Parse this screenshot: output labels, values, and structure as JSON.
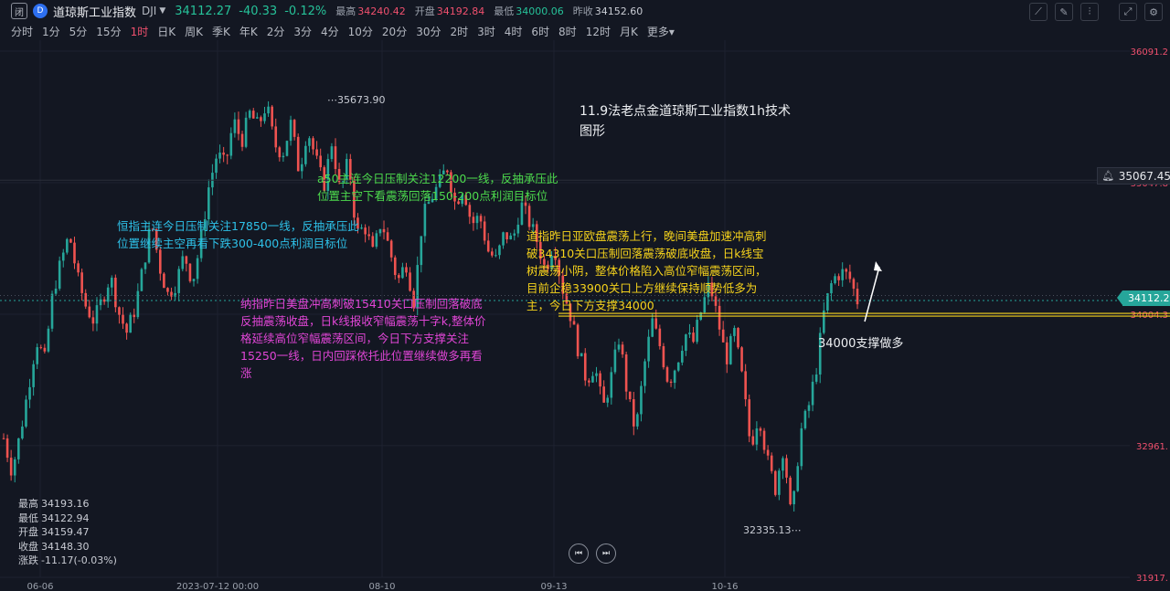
{
  "header": {
    "closed_badge": "闭",
    "logo_glyph": "D",
    "symbol_name": "道琼斯工业指数",
    "ticker": "DJI",
    "price": "34112.27",
    "change": "-40.33",
    "change_pct": "-0.12%",
    "high_label": "最高",
    "high": "34240.42",
    "open_label": "开盘",
    "open": "34192.84",
    "low_label": "最低",
    "low": "34000.06",
    "prev_label": "昨收",
    "prev": "34152.60",
    "tools": [
      "draw-line-icon",
      "pencil-icon",
      "indicator-icon",
      "fullscreen-icon",
      "settings-icon"
    ]
  },
  "intervals": [
    "分时",
    "1分",
    "5分",
    "15分",
    "1时",
    "日K",
    "周K",
    "季K",
    "年K",
    "2分",
    "3分",
    "4分",
    "10分",
    "20分",
    "30分",
    "2时",
    "3时",
    "4时",
    "6时",
    "8时",
    "12时",
    "月K",
    "更多▾"
  ],
  "active_interval": "1时",
  "annotations": {
    "title_line1": "11.9法老点金道琼斯工业指数1h技术",
    "title_line2": "图形",
    "a50_line1": "a50主连今日压制关注12200一线，反抽承压此",
    "a50_line2": "位置主空下看震荡回落150-200点利润目标位",
    "hsi_line1": "恒指主连今日压制关注17850一线，反抽承压此",
    "hsi_line2": "位置继续主空再看下跌300-400点利润目标位",
    "nas_line1": "纳指昨日美盘冲高刺破15410关口压制回落破底",
    "nas_line2": "反抽震荡收盘，日k线报收窄幅震荡十字k,整体价",
    "nas_line3": "格延续高位窄幅震荡区间，今日下方支撑关注",
    "nas_line4": "15250一线，日内回踩依托此位置继续做多再看",
    "nas_line5": "涨",
    "dji_line1": "道指昨日亚欧盘震荡上行，晚间美盘加速冲高刺",
    "dji_line2": "破34310关口压制回落震荡破底收盘，日k线宝",
    "dji_line3": "树震荡小阴，整体价格陷入高位窄幅震荡区间，",
    "dji_line4": "目前企稳33900关口上方继续保持顺势低多为",
    "dji_line5": "主，今日下方支撑34000",
    "support_label": "34000支撑做多"
  },
  "ohlc_panel": {
    "high_label": "最高",
    "high": "34193.16",
    "low_label": "最低",
    "low": "34122.94",
    "open_label": "开盘",
    "open": "34159.47",
    "close_label": "收盘",
    "close": "34148.30",
    "change_label": "涨跌",
    "change": "-11.17(-0.03%)"
  },
  "playback": [
    "previous-icon",
    "next-icon"
  ],
  "price_tags": {
    "current": "34112.27",
    "alert": "35067.45"
  },
  "colors": {
    "background": "#131722",
    "up": "#26a69a",
    "down": "#ef5350",
    "support_line": "#f5d21c",
    "current_tag": "#26a69a"
  },
  "chart_data": {
    "type": "candlestick",
    "y_axis_ticks": [
      "36091.2",
      "35047.8",
      "34004.3",
      "32961.",
      "31917."
    ],
    "x_axis_ticks": [
      "06-06",
      "2023-07-12 00:00",
      "08-10",
      "09-13",
      "10-16"
    ],
    "ylim": [
      31917,
      36091
    ],
    "peak_label": "35673.90",
    "trough_label": "32335.13",
    "support_level": 34000,
    "current_price": 34112.27,
    "alert_price": 35067.45,
    "close_series": [
      33020,
      32760,
      33050,
      33420,
      33800,
      33640,
      34180,
      34420,
      34640,
      34290,
      34070,
      33950,
      34120,
      34310,
      34020,
      33860,
      34050,
      34380,
      34740,
      34380,
      34160,
      34250,
      34480,
      34260,
      34580,
      35020,
      35280,
      35180,
      35540,
      35380,
      35600,
      35490,
      35673,
      35350,
      35280,
      35520,
      35130,
      35480,
      35240,
      35020,
      35380,
      34960,
      35230,
      34640,
      34700,
      34480,
      34750,
      34520,
      34260,
      34420,
      34100,
      34760,
      34920,
      35030,
      35180,
      34880,
      35020,
      34720,
      34780,
      34510,
      34430,
      34650,
      34580,
      34880,
      34740,
      34580,
      34350,
      34580,
      34230,
      34010,
      33720,
      33480,
      33600,
      33250,
      33500,
      33830,
      33350,
      33070,
      33580,
      33950,
      33740,
      33460,
      33620,
      33850,
      33780,
      34040,
      34250,
      33960,
      33640,
      33860,
      33480,
      32950,
      33220,
      32850,
      32620,
      32960,
      32335,
      33050,
      33250,
      33580,
      34050,
      34280,
      34340,
      34300,
      34112
    ]
  }
}
